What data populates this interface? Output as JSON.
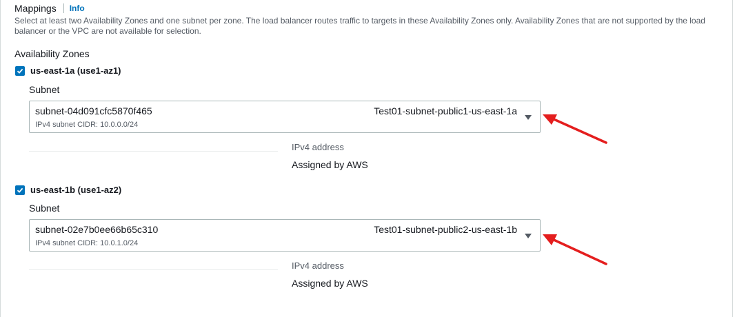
{
  "section": {
    "title": "Mappings",
    "info_link": "Info",
    "description": "Select at least two Availability Zones and one subnet per zone. The load balancer routes traffic to targets in these Availability Zones only. Availability Zones that are not supported by the load balancer or the VPC are not available for selection.",
    "az_heading": "Availability Zones"
  },
  "zones": [
    {
      "label": "us-east-1a (use1-az1)",
      "checked": true,
      "subnet_label": "Subnet",
      "subnet_id": "subnet-04d091cfc5870f465",
      "subnet_cidr": "IPv4 subnet CIDR: 10.0.0.0/24",
      "subnet_name": "Test01-subnet-public1-us-east-1a",
      "ipv4_label": "IPv4 address",
      "ipv4_value": "Assigned by AWS"
    },
    {
      "label": "us-east-1b (use1-az2)",
      "checked": true,
      "subnet_label": "Subnet",
      "subnet_id": "subnet-02e7b0ee66b65c310",
      "subnet_cidr": "IPv4 subnet CIDR: 10.0.1.0/24",
      "subnet_name": "Test01-subnet-public2-us-east-1b",
      "ipv4_label": "IPv4 address",
      "ipv4_value": "Assigned by AWS"
    }
  ],
  "colors": {
    "accent": "#0073bb",
    "annotation_arrow": "#e41e1e",
    "border": "#aab7b8",
    "secondary_text": "#545b64"
  },
  "icons": {
    "checkbox": "checkmark-icon",
    "dropdown": "caret-down-icon",
    "annotation": "red-arrow-icon"
  }
}
